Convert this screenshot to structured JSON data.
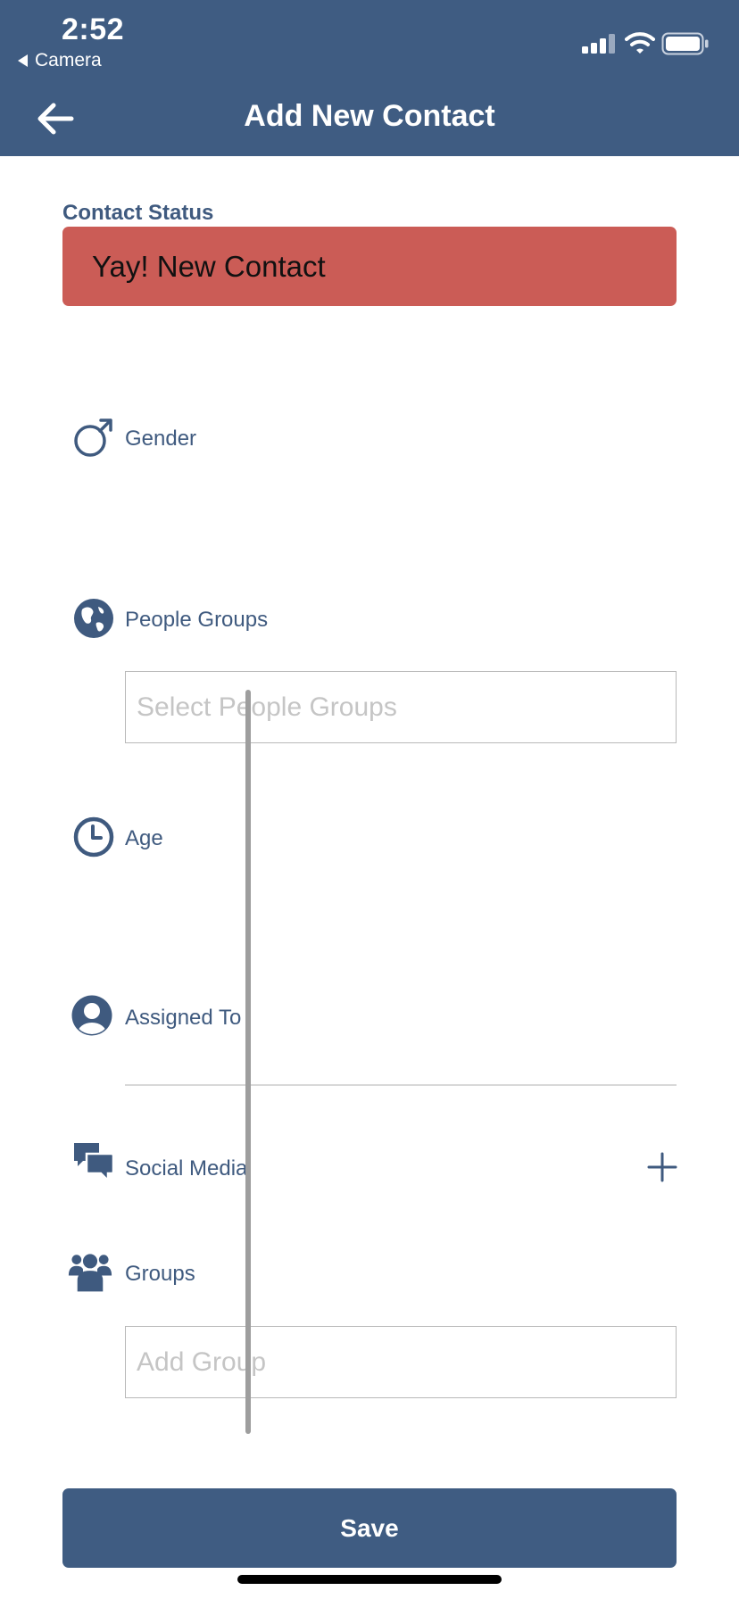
{
  "status_bar": {
    "time": "2:52",
    "back_app": "Camera"
  },
  "header": {
    "title": "Add New Contact"
  },
  "contact_status": {
    "label": "Contact Status",
    "value": "Yay! New Contact",
    "color": "#cb5c56"
  },
  "fields": {
    "gender": {
      "label": "Gender",
      "icon": "male-icon"
    },
    "people_groups": {
      "label": "People Groups",
      "icon": "globe-icon",
      "placeholder": "Select People Groups"
    },
    "age": {
      "label": "Age",
      "icon": "clock-icon"
    },
    "assigned_to": {
      "label": "Assigned To",
      "icon": "user-icon"
    },
    "social_media": {
      "label": "Social Media",
      "icon": "chat-icon",
      "add_icon": "plus-icon"
    },
    "groups": {
      "label": "Groups",
      "icon": "people-icon",
      "placeholder": "Add Group"
    }
  },
  "save_button": {
    "label": "Save"
  },
  "colors": {
    "primary": "#3f5c82",
    "text": "#3f5a7f"
  }
}
